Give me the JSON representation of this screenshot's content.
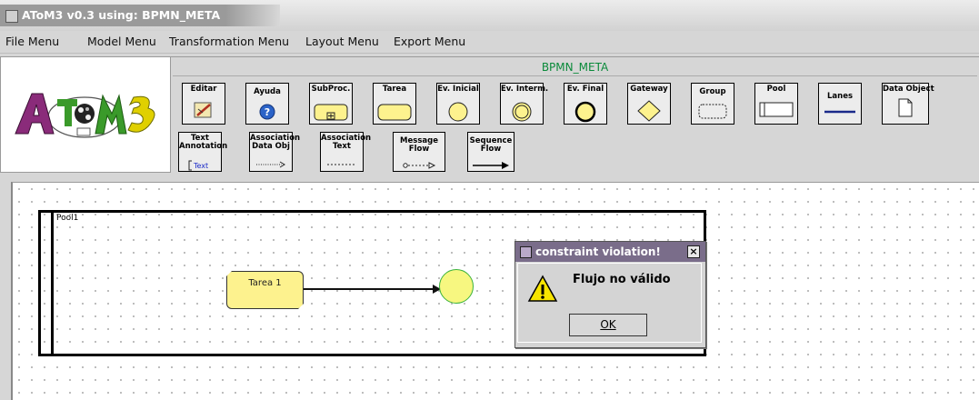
{
  "window": {
    "title": "AToM3 v0.3 using: BPMN_META"
  },
  "menubar": {
    "items": [
      "File Menu",
      "Model Menu",
      "Transformation Menu",
      "Layout Menu",
      "Export Menu"
    ]
  },
  "logo": {
    "text": "AToM3"
  },
  "toolbar": {
    "title": "BPMN_META",
    "row1": [
      {
        "label": "Editar",
        "icon": "editar-icon"
      },
      {
        "label": "Ayuda",
        "icon": "help-icon"
      },
      {
        "label": "SubProc.",
        "icon": "subprocess-icon"
      },
      {
        "label": "Tarea",
        "icon": "task-icon"
      },
      {
        "label": "Ev. Inicial",
        "icon": "start-event-icon"
      },
      {
        "label": "Ev. Interm.",
        "icon": "intermediate-event-icon"
      },
      {
        "label": "Ev. Final",
        "icon": "end-event-icon"
      },
      {
        "label": "Gateway",
        "icon": "gateway-icon"
      },
      {
        "label": "Group",
        "icon": "group-icon"
      },
      {
        "label": "Pool",
        "icon": "pool-icon"
      },
      {
        "label": "Lanes",
        "icon": "lanes-icon"
      },
      {
        "label": "Data Object",
        "icon": "data-object-icon"
      }
    ],
    "row2": [
      {
        "label": "Text Annotation",
        "sub": "Text",
        "icon": "text-annotation-icon"
      },
      {
        "label": "Association Data Obj",
        "icon": "association-data-icon"
      },
      {
        "label": "Association Text",
        "icon": "association-text-icon"
      },
      {
        "label": "Message Flow",
        "icon": "message-flow-icon"
      },
      {
        "label": "Sequence Flow",
        "icon": "sequence-flow-icon"
      }
    ]
  },
  "canvas": {
    "pool_label": "Pool1",
    "task_label": "Tarea 1"
  },
  "dialog": {
    "title": "constraint violation!",
    "close": "×",
    "message": "Flujo no válido",
    "ok": "OK"
  }
}
